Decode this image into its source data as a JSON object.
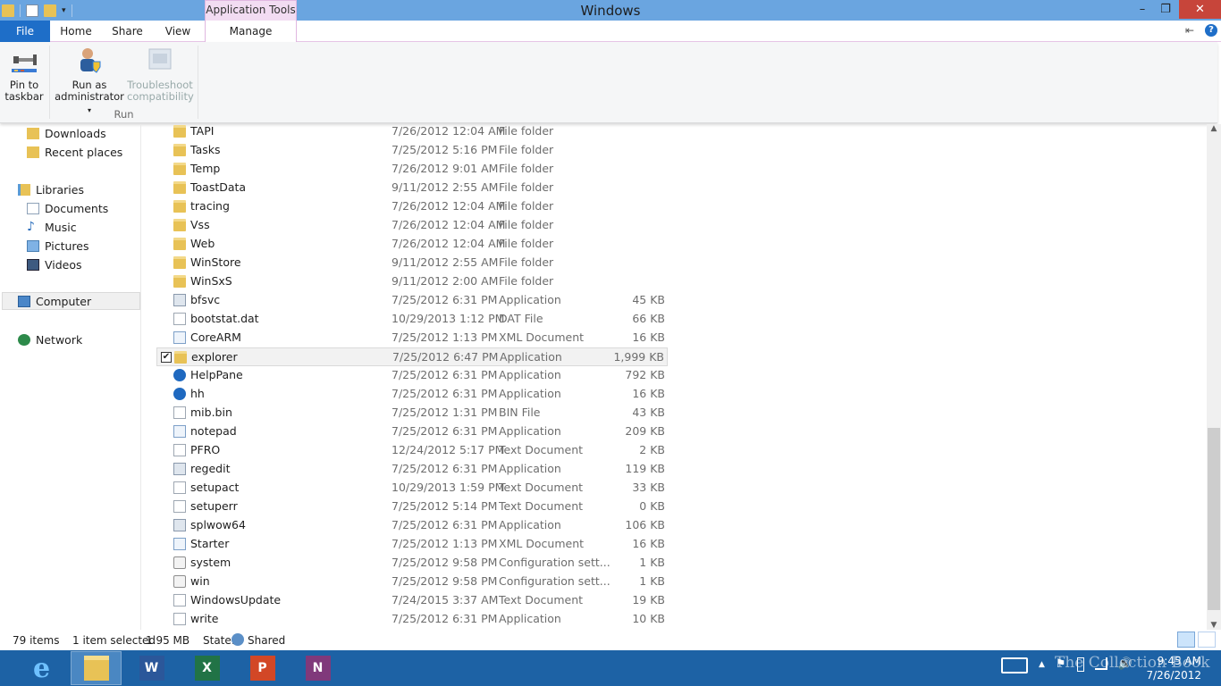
{
  "window": {
    "title": "Windows",
    "context_tab_group": "Application Tools",
    "minimize_glyph": "–",
    "restore_glyph": "❐",
    "close_glyph": "✕"
  },
  "tabs": {
    "file": "File",
    "home": "Home",
    "share": "Share",
    "view": "View",
    "manage": "Manage"
  },
  "ribbon": {
    "pin_label_1": "Pin to",
    "pin_label_2": "taskbar",
    "runas_label_1": "Run as",
    "runas_label_2": "administrator",
    "trouble_label_1": "Troubleshoot",
    "trouble_label_2": "compatibility",
    "group_run": "Run"
  },
  "nav": {
    "downloads": "Downloads",
    "recent": "Recent places",
    "libraries": "Libraries",
    "documents": "Documents",
    "music": "Music",
    "pictures": "Pictures",
    "videos": "Videos",
    "computer": "Computer",
    "network": "Network"
  },
  "files": [
    {
      "name": "TAPI",
      "date": "7/26/2012 12:04 AM",
      "type": "File folder",
      "size": "",
      "icon": "folder-icon"
    },
    {
      "name": "Tasks",
      "date": "7/25/2012 5:16 PM",
      "type": "File folder",
      "size": "",
      "icon": "folder-icon"
    },
    {
      "name": "Temp",
      "date": "7/26/2012 9:01 AM",
      "type": "File folder",
      "size": "",
      "icon": "folder-icon"
    },
    {
      "name": "ToastData",
      "date": "9/11/2012 2:55 AM",
      "type": "File folder",
      "size": "",
      "icon": "folder-icon"
    },
    {
      "name": "tracing",
      "date": "7/26/2012 12:04 AM",
      "type": "File folder",
      "size": "",
      "icon": "folder-icon"
    },
    {
      "name": "Vss",
      "date": "7/26/2012 12:04 AM",
      "type": "File folder",
      "size": "",
      "icon": "folder-icon"
    },
    {
      "name": "Web",
      "date": "7/26/2012 12:04 AM",
      "type": "File folder",
      "size": "",
      "icon": "folder-icon"
    },
    {
      "name": "WinStore",
      "date": "9/11/2012 2:55 AM",
      "type": "File folder",
      "size": "",
      "icon": "folder-icon"
    },
    {
      "name": "WinSxS",
      "date": "9/11/2012 2:00 AM",
      "type": "File folder",
      "size": "",
      "icon": "folder-icon"
    },
    {
      "name": "bfsvc",
      "date": "7/25/2012 6:31 PM",
      "type": "Application",
      "size": "45 KB",
      "icon": "app-icon"
    },
    {
      "name": "bootstat.dat",
      "date": "10/29/2013 1:12 PM",
      "type": "DAT File",
      "size": "66 KB",
      "icon": "file-icon"
    },
    {
      "name": "CoreARM",
      "date": "7/25/2012 1:13 PM",
      "type": "XML Document",
      "size": "16 KB",
      "icon": "xml-icon"
    },
    {
      "name": "explorer",
      "date": "7/25/2012 6:47 PM",
      "type": "Application",
      "size": "1,999 KB",
      "icon": "explorer-icon",
      "selected": true
    },
    {
      "name": "HelpPane",
      "date": "7/25/2012 6:31 PM",
      "type": "Application",
      "size": "792 KB",
      "icon": "help-icon"
    },
    {
      "name": "hh",
      "date": "7/25/2012 6:31 PM",
      "type": "Application",
      "size": "16 KB",
      "icon": "hh-icon"
    },
    {
      "name": "mib.bin",
      "date": "7/25/2012 1:31 PM",
      "type": "BIN File",
      "size": "43 KB",
      "icon": "file-icon"
    },
    {
      "name": "notepad",
      "date": "7/25/2012 6:31 PM",
      "type": "Application",
      "size": "209 KB",
      "icon": "notepad-icon"
    },
    {
      "name": "PFRO",
      "date": "12/24/2012 5:17 PM",
      "type": "Text Document",
      "size": "2 KB",
      "icon": "text-file-icon"
    },
    {
      "name": "regedit",
      "date": "7/25/2012 6:31 PM",
      "type": "Application",
      "size": "119 KB",
      "icon": "regedit-icon"
    },
    {
      "name": "setupact",
      "date": "10/29/2013 1:59 PM",
      "type": "Text Document",
      "size": "33 KB",
      "icon": "text-file-icon"
    },
    {
      "name": "setuperr",
      "date": "7/25/2012 5:14 PM",
      "type": "Text Document",
      "size": "0 KB",
      "icon": "text-file-icon"
    },
    {
      "name": "splwow64",
      "date": "7/25/2012 6:31 PM",
      "type": "Application",
      "size": "106 KB",
      "icon": "printer-icon"
    },
    {
      "name": "Starter",
      "date": "7/25/2012 1:13 PM",
      "type": "XML Document",
      "size": "16 KB",
      "icon": "xml-icon"
    },
    {
      "name": "system",
      "date": "7/25/2012 9:58 PM",
      "type": "Configuration sett...",
      "size": "1 KB",
      "icon": "config-icon"
    },
    {
      "name": "win",
      "date": "7/25/2012 9:58 PM",
      "type": "Configuration sett...",
      "size": "1 KB",
      "icon": "config-icon"
    },
    {
      "name": "WindowsUpdate",
      "date": "7/24/2015 3:37 AM",
      "type": "Text Document",
      "size": "19 KB",
      "icon": "text-file-icon"
    },
    {
      "name": "write",
      "date": "7/25/2012 6:31 PM",
      "type": "Application",
      "size": "10 KB",
      "icon": "write-icon"
    }
  ],
  "status": {
    "count": "79 items",
    "selected": "1 item selected",
    "size": "1.95 MB",
    "state_label": "State:",
    "state_value": "Shared"
  },
  "taskbar": {
    "ie": "e",
    "word": "W",
    "excel": "X",
    "powerpoint": "P",
    "onenote": "N"
  },
  "tray": {
    "time": "9:45 AM",
    "date": "7/26/2012",
    "flag": "⚑",
    "arrow": "▲",
    "volume": "🔊"
  },
  "watermark": "The Collection Book",
  "colors": {
    "titlebar": "#6aa5e0",
    "file_tab": "#1e6ec8",
    "manage_tint": "#f2dcf2",
    "taskbar": "#1d62a5",
    "close": "#c7453a"
  }
}
